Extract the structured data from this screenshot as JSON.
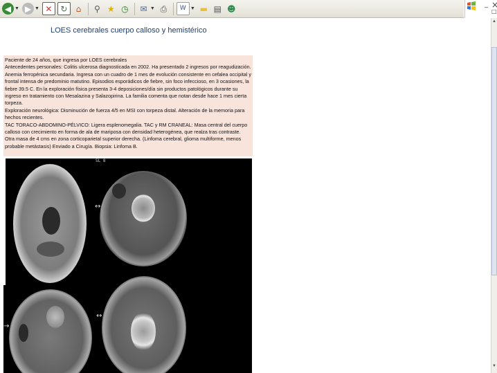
{
  "toolbar": {
    "icons": [
      "back-icon",
      "forward-icon",
      "stop-icon",
      "refresh-icon",
      "home-icon",
      "search-icon",
      "favorites-icon",
      "history-icon",
      "mail-icon",
      "print-icon",
      "edit-icon",
      "discuss-icon",
      "folder-icon",
      "research-icon",
      "messenger-icon"
    ]
  },
  "window": {
    "minimize": "_",
    "maximize": "□",
    "close": "×"
  },
  "slide": {
    "title": "LOES cerebrales cuerpo calloso y hemistérico",
    "paragraphs": [
      "Paciente de 24 años, que ingresa por LOES cerebrales",
      "Antecedentes personales: Colitis ulcerosa diagnosticada en 2002. Ha presentado 2 ingresos por reagudización. Anemia ferropénica secundaria. Ingresa con un cuadro de 1 mes de evolución consistente en cefalea occipital y frontal intensa de predominio matutino. Episodios esporádicos de fiebre, sin foco infeccioso, en 3 ocasiones, la fiebre 39.5 C. En la exploración física presenta 3-4 deposiciones/día sin productos patológicos durante su ingreso en tratamiento con Mesalazina y Salazopirina. La familia comenta que notan desde hace 1 mes cierta torpeza.",
      "Exploración neurológica: Disminución de fuerza 4/5 en MSI con torpeza distal. Alteración de la memoria para hechos recientes.",
      "TAC TORACO-ABDOMINO-PÉLVICO: Ligera esplenomegalia. TAC y RM CRANEAL: Masa central del cuerpo calloso con crecimiento en forma de ala de mariposa con densidad heterogénea, que realza tras contraste. Otra masa de 4 cms en zona corticoparietal superior derecha. (Linfoma cerebral, glioma multiforme, menos probable metástasis) Enviado a Cirugía. Biopsia: Linfoma B."
    ]
  },
  "scans": {
    "coronal_label": "SL 8"
  },
  "colors": {
    "title": "#1f3f6f",
    "textbox_bg": "#f9e4dc",
    "image_bg": "#000000"
  }
}
